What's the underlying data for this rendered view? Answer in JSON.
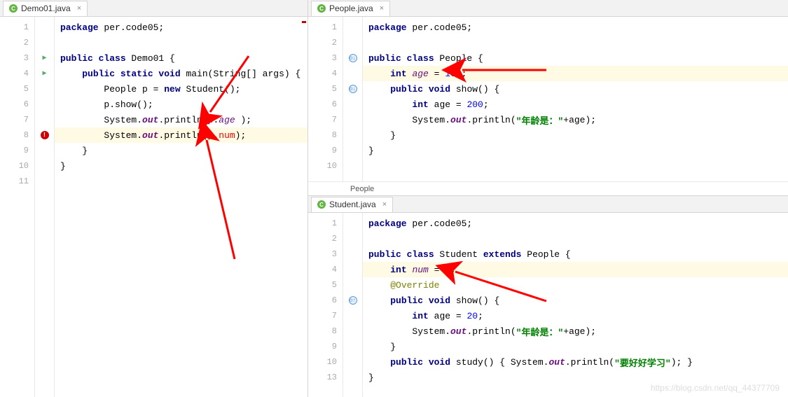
{
  "left": {
    "tab": {
      "icon": "C",
      "label": "Demo01.java"
    },
    "lines": [
      {
        "n": 1,
        "tokens": [
          {
            "t": "package ",
            "c": "kw"
          },
          {
            "t": "per.code05;",
            "c": "plain"
          }
        ]
      },
      {
        "n": 2,
        "tokens": []
      },
      {
        "n": 3,
        "mark": "run",
        "tokens": [
          {
            "t": "public class ",
            "c": "kw"
          },
          {
            "t": "Demo01 {",
            "c": "plain"
          }
        ]
      },
      {
        "n": 4,
        "mark": "run",
        "tokens": [
          {
            "t": "    ",
            "c": "plain"
          },
          {
            "t": "public static void ",
            "c": "kw"
          },
          {
            "t": "main(String[] args) {",
            "c": "plain"
          }
        ]
      },
      {
        "n": 5,
        "tokens": [
          {
            "t": "        People p = ",
            "c": "plain"
          },
          {
            "t": "new ",
            "c": "kw"
          },
          {
            "t": "Student();",
            "c": "plain"
          }
        ]
      },
      {
        "n": 6,
        "tokens": [
          {
            "t": "        p.show();",
            "c": "plain"
          }
        ]
      },
      {
        "n": 7,
        "tokens": [
          {
            "t": "        System.",
            "c": "plain"
          },
          {
            "t": "out",
            "c": "static-field"
          },
          {
            "t": ".println(p.",
            "c": "plain"
          },
          {
            "t": "age",
            "c": "field"
          },
          {
            "t": " );",
            "c": "plain"
          }
        ]
      },
      {
        "n": 8,
        "mark": "error",
        "hl": true,
        "tokens": [
          {
            "t": "        System.",
            "c": "plain"
          },
          {
            "t": "out",
            "c": "static-field"
          },
          {
            "t": ".println(p.",
            "c": "plain"
          },
          {
            "t": "num",
            "c": "err"
          },
          {
            "t": ");",
            "c": "plain"
          }
        ]
      },
      {
        "n": 9,
        "tokens": [
          {
            "t": "    }",
            "c": "plain"
          }
        ]
      },
      {
        "n": 10,
        "tokens": [
          {
            "t": "}",
            "c": "plain"
          }
        ]
      },
      {
        "n": 11,
        "tokens": []
      }
    ]
  },
  "rightTop": {
    "tab": {
      "icon": "C",
      "label": "People.java"
    },
    "breadcrumb": "People",
    "lines": [
      {
        "n": 1,
        "tokens": [
          {
            "t": "package ",
            "c": "kw"
          },
          {
            "t": "per.code05;",
            "c": "plain"
          }
        ]
      },
      {
        "n": 2,
        "tokens": []
      },
      {
        "n": 3,
        "mark": "override-down",
        "tokens": [
          {
            "t": "public class ",
            "c": "kw"
          },
          {
            "t": "People {",
            "c": "plain"
          }
        ]
      },
      {
        "n": 4,
        "hl": true,
        "tokens": [
          {
            "t": "    ",
            "c": "plain"
          },
          {
            "t": "int ",
            "c": "kw"
          },
          {
            "t": "age",
            "c": "field"
          },
          {
            "t": " = ",
            "c": "plain"
          },
          {
            "t": "100",
            "c": "num"
          },
          {
            "t": ";",
            "c": "plain"
          }
        ]
      },
      {
        "n": 5,
        "mark": "override-down",
        "tokens": [
          {
            "t": "    ",
            "c": "plain"
          },
          {
            "t": "public void ",
            "c": "kw"
          },
          {
            "t": "show() {",
            "c": "plain"
          }
        ]
      },
      {
        "n": 6,
        "tokens": [
          {
            "t": "        ",
            "c": "plain"
          },
          {
            "t": "int ",
            "c": "kw"
          },
          {
            "t": "age = ",
            "c": "plain"
          },
          {
            "t": "200",
            "c": "num"
          },
          {
            "t": ";",
            "c": "plain"
          }
        ]
      },
      {
        "n": 7,
        "tokens": [
          {
            "t": "        System.",
            "c": "plain"
          },
          {
            "t": "out",
            "c": "static-field"
          },
          {
            "t": ".println(",
            "c": "plain"
          },
          {
            "t": "\"年龄是：\"",
            "c": "str"
          },
          {
            "t": "+age);",
            "c": "plain"
          }
        ]
      },
      {
        "n": 8,
        "tokens": [
          {
            "t": "    }",
            "c": "plain"
          }
        ]
      },
      {
        "n": 9,
        "tokens": [
          {
            "t": "}",
            "c": "plain"
          }
        ]
      },
      {
        "n": 10,
        "tokens": []
      }
    ]
  },
  "rightBottom": {
    "tab": {
      "icon": "C",
      "label": "Student.java"
    },
    "lines": [
      {
        "n": 1,
        "tokens": [
          {
            "t": "package ",
            "c": "kw"
          },
          {
            "t": "per.code05;",
            "c": "plain"
          }
        ]
      },
      {
        "n": 2,
        "tokens": []
      },
      {
        "n": 3,
        "tokens": [
          {
            "t": "public class ",
            "c": "kw"
          },
          {
            "t": "Student ",
            "c": "plain"
          },
          {
            "t": "extends ",
            "c": "kw"
          },
          {
            "t": "People {",
            "c": "plain"
          }
        ]
      },
      {
        "n": 4,
        "hl": true,
        "tokens": [
          {
            "t": "    ",
            "c": "plain"
          },
          {
            "t": "int ",
            "c": "kw"
          },
          {
            "t": "num",
            "c": "field"
          },
          {
            "t": " = ",
            "c": "plain"
          },
          {
            "t": "6",
            "c": "num"
          },
          {
            "t": ";",
            "c": "plain"
          }
        ]
      },
      {
        "n": 5,
        "tokens": [
          {
            "t": "    ",
            "c": "plain"
          },
          {
            "t": "@Override",
            "c": "ann"
          }
        ]
      },
      {
        "n": 6,
        "mark": "override-up",
        "tokens": [
          {
            "t": "    ",
            "c": "plain"
          },
          {
            "t": "public void ",
            "c": "kw"
          },
          {
            "t": "show() {",
            "c": "plain"
          }
        ]
      },
      {
        "n": 7,
        "tokens": [
          {
            "t": "        ",
            "c": "plain"
          },
          {
            "t": "int ",
            "c": "kw"
          },
          {
            "t": "age = ",
            "c": "plain"
          },
          {
            "t": "20",
            "c": "num"
          },
          {
            "t": ";",
            "c": "plain"
          }
        ]
      },
      {
        "n": 8,
        "tokens": [
          {
            "t": "        System.",
            "c": "plain"
          },
          {
            "t": "out",
            "c": "static-field"
          },
          {
            "t": ".println(",
            "c": "plain"
          },
          {
            "t": "\"年龄是：\"",
            "c": "str"
          },
          {
            "t": "+age);",
            "c": "plain"
          }
        ]
      },
      {
        "n": 9,
        "tokens": [
          {
            "t": "    }",
            "c": "plain"
          }
        ]
      },
      {
        "n": 10,
        "tokens": [
          {
            "t": "    ",
            "c": "plain"
          },
          {
            "t": "public void ",
            "c": "kw"
          },
          {
            "t": "study() { System.",
            "c": "plain"
          },
          {
            "t": "out",
            "c": "static-field"
          },
          {
            "t": ".println(",
            "c": "plain"
          },
          {
            "t": "\"要好好学习\"",
            "c": "str"
          },
          {
            "t": "); }",
            "c": "plain"
          }
        ]
      },
      {
        "n": 13,
        "tokens": [
          {
            "t": "}",
            "c": "plain"
          }
        ]
      }
    ]
  },
  "watermark": "https://blog.csdn.net/qq_44377709"
}
